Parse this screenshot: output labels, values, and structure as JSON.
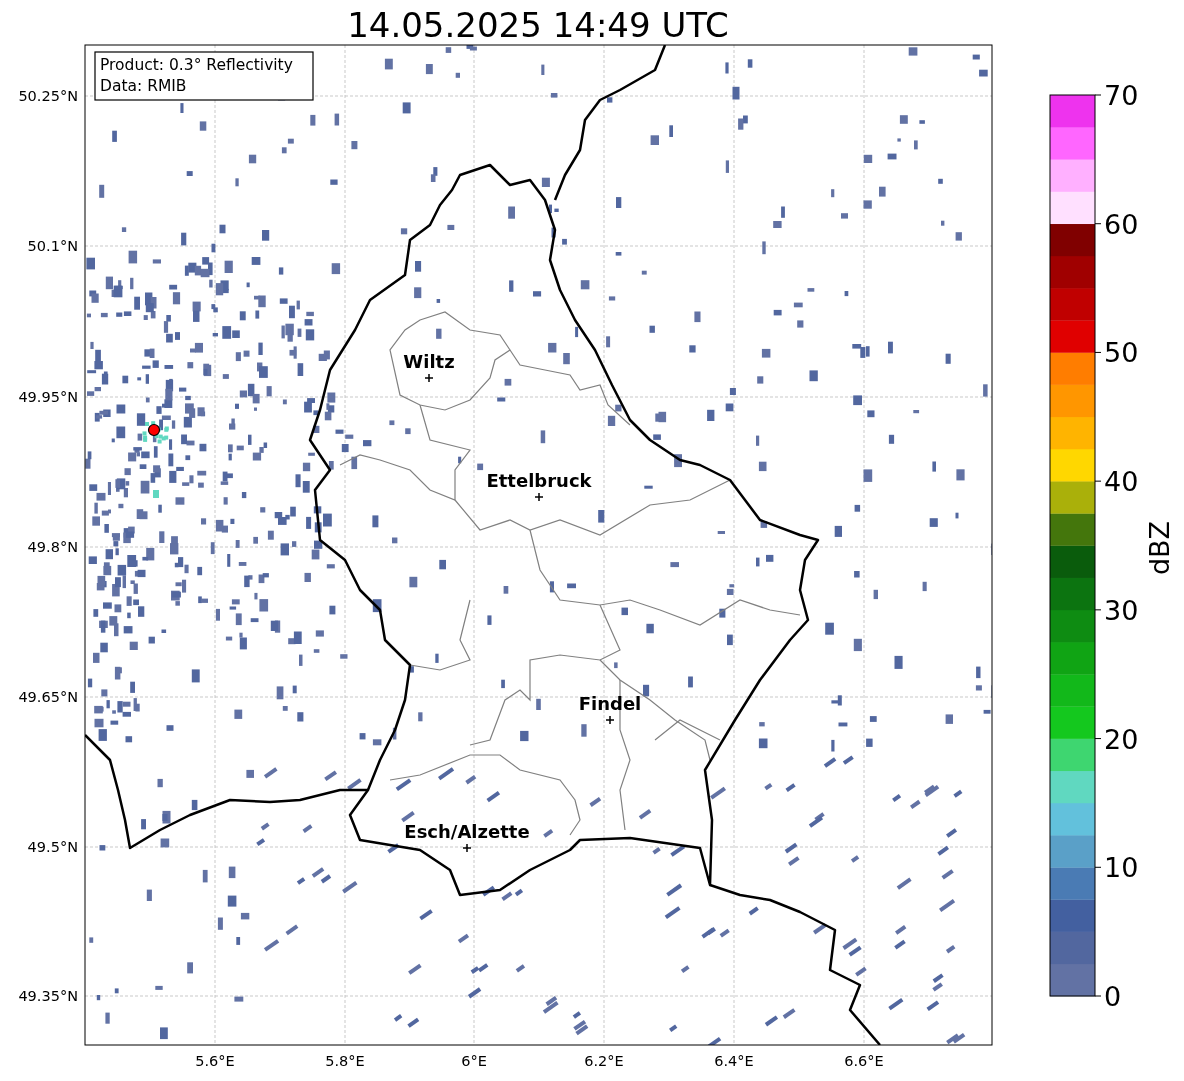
{
  "title": "14.05.2025 14:49 UTC",
  "info_box": [
    "Product: 0.3° Reflectivity",
    "Data: RMIB"
  ],
  "map": {
    "xticks": [
      "5.6°E",
      "5.8°E",
      "6°E",
      "6.2°E",
      "6.4°E",
      "6.6°E"
    ],
    "yticks": [
      "50.25°N",
      "50.1°N",
      "49.95°N",
      "49.8°N",
      "49.65°N",
      "49.5°N",
      "49.35°N"
    ],
    "cities": [
      {
        "name": "Wiltz"
      },
      {
        "name": "Ettelbruck"
      },
      {
        "name": "Findel"
      },
      {
        "name": "Esch/Alzette"
      }
    ]
  },
  "colorbar": {
    "label": "dBZ",
    "ticks": [
      "70",
      "60",
      "50",
      "40",
      "30",
      "20",
      "10",
      "0"
    ],
    "bins": [
      {
        "color": "#6272a4"
      },
      {
        "color": "#52679f"
      },
      {
        "color": "#4360a0"
      },
      {
        "color": "#4a7bb4"
      },
      {
        "color": "#5aa0c8"
      },
      {
        "color": "#62c1dc"
      },
      {
        "color": "#60d8c0"
      },
      {
        "color": "#3ed670"
      },
      {
        "color": "#14c81e"
      },
      {
        "color": "#12b81a"
      },
      {
        "color": "#10a414"
      },
      {
        "color": "#0e8c12"
      },
      {
        "color": "#0c7410"
      },
      {
        "color": "#0a5c0c"
      },
      {
        "color": "#44760c"
      },
      {
        "color": "#aab00a"
      },
      {
        "color": "#ffd700"
      },
      {
        "color": "#ffb400"
      },
      {
        "color": "#ff9600"
      },
      {
        "color": "#ff7d00"
      },
      {
        "color": "#e00000"
      },
      {
        "color": "#c00000"
      },
      {
        "color": "#a00000"
      },
      {
        "color": "#800000"
      },
      {
        "color": "#ffe0ff"
      },
      {
        "color": "#ffb0ff"
      },
      {
        "color": "#ff66ff"
      },
      {
        "color": "#ee33ee"
      }
    ]
  }
}
